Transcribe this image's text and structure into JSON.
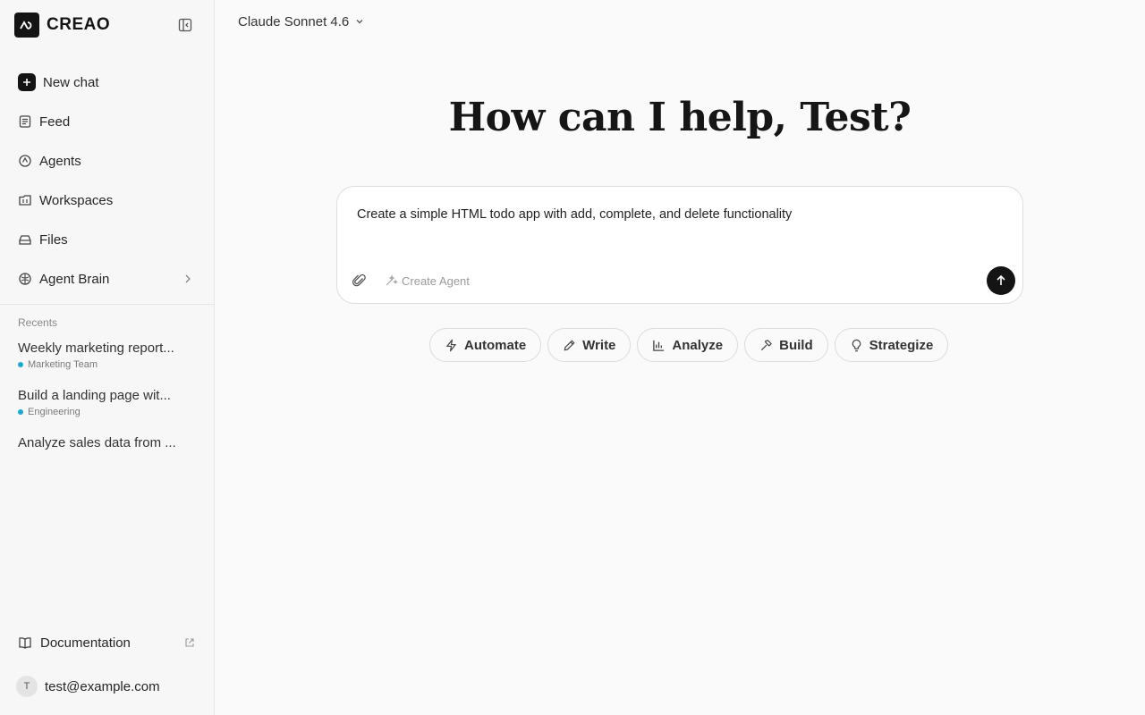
{
  "brand": {
    "name": "CREAO"
  },
  "sidebar": {
    "nav": [
      {
        "label": "New chat",
        "icon": "plus-icon"
      },
      {
        "label": "Feed",
        "icon": "newspaper-icon"
      },
      {
        "label": "Agents",
        "icon": "agent-icon"
      },
      {
        "label": "Workspaces",
        "icon": "folder-icon"
      },
      {
        "label": "Files",
        "icon": "drive-icon"
      },
      {
        "label": "Agent Brain",
        "icon": "brain-icon"
      }
    ],
    "recents_label": "Recents",
    "recents": [
      {
        "title": "Weekly marketing report...",
        "tag": "Marketing Team"
      },
      {
        "title": "Build a landing page wit...",
        "tag": "Engineering"
      },
      {
        "title": "Analyze sales data from ...",
        "tag": ""
      }
    ],
    "documentation": "Documentation",
    "user": {
      "initial": "T",
      "email": "test@example.com"
    }
  },
  "main": {
    "model": "Claude Sonnet 4.6",
    "headline": "How can I help, Test?",
    "composer": {
      "value": "Create a simple HTML todo app with add, complete, and delete functionality",
      "create_agent": "Create Agent"
    },
    "chips": [
      {
        "label": "Automate",
        "icon": "bolt-icon"
      },
      {
        "label": "Write",
        "icon": "pen-icon"
      },
      {
        "label": "Analyze",
        "icon": "bar-chart-icon"
      },
      {
        "label": "Build",
        "icon": "hammer-icon"
      },
      {
        "label": "Strategize",
        "icon": "lightbulb-icon"
      }
    ]
  },
  "colors": {
    "accent": "#141414",
    "tag_dot": "#1ea7d6"
  }
}
